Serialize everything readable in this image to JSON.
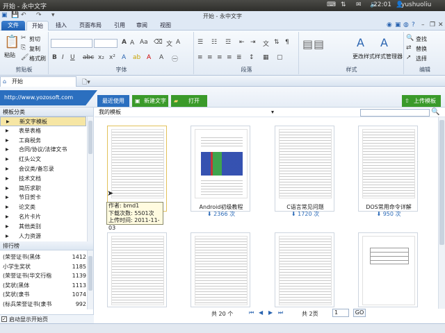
{
  "system_bar": {
    "window_title": "开始 - 永中文字",
    "time": "22:01",
    "user": "yushuoliu"
  },
  "app": {
    "title": "开始 - 永中文字"
  },
  "ribbon_tabs": [
    "文件",
    "开始",
    "插入",
    "页面布局",
    "引用",
    "审阅",
    "视图"
  ],
  "ribbon_groups": {
    "clipboard": {
      "label": "剪贴板",
      "paste": "粘贴",
      "cut": "剪切",
      "copy": "复制",
      "format_painter": "格式刷"
    },
    "font": {
      "label": "字体"
    },
    "paragraph": {
      "label": "段落"
    },
    "style": {
      "label": "样式",
      "change_style": "更改样式",
      "style_manager": "样式管理器"
    },
    "edit": {
      "label": "编辑",
      "find": "查找",
      "replace": "替换",
      "select": "选择"
    }
  },
  "doc_tab": {
    "label": "开始"
  },
  "banner": {
    "url": "http://www.yozosoft.com",
    "recent": "最近使用",
    "new_text": "新建文字",
    "open": "打开",
    "upload": "上传模板"
  },
  "sidebar": {
    "category_title": "模板分类",
    "categories": [
      "新文字模板",
      "表单表格",
      "工商税务",
      "合同/协议/法律文书",
      "红头公文",
      "会议类/备忘录",
      "技术文档",
      "简历求职",
      "节日贺卡",
      "论文类",
      "名片卡片",
      "其他类别",
      "人力资源"
    ],
    "ranking_title": "排行榜",
    "ranking": [
      {
        "name": "(荣誉证书(黑体",
        "count": "1412"
      },
      {
        "name": "小学生奖状",
        "count": "1185"
      },
      {
        "name": "(荣誉证书(华文行楷",
        "count": "1139"
      },
      {
        "name": "(奖状(黑体",
        "count": "1113"
      },
      {
        "name": "(奖状(隶书",
        "count": "1074"
      },
      {
        "name": "(标兵荣誉证书(隶书",
        "count": "992"
      }
    ],
    "startup_check": "启动显示开始页"
  },
  "content": {
    "heading": "我的模板",
    "sort": "▾",
    "cards": [
      {
        "name": "",
        "count": ""
      },
      {
        "name": "Android初级教程",
        "count": "2366 次"
      },
      {
        "name": "C语言常见问题",
        "count": "1720 次"
      },
      {
        "name": "DOS常用命令详解",
        "count": "950 次"
      },
      {
        "name": "",
        "count": ""
      },
      {
        "name": "",
        "count": ""
      },
      {
        "name": "",
        "count": ""
      },
      {
        "name": "",
        "count": ""
      }
    ],
    "tooltip": {
      "author": "作者: bmd1",
      "downloads": "下载次数: 5501次",
      "upload_time": "上传时间: 2011-11-03"
    },
    "pager": {
      "total": "共 20 个",
      "pages": "共 2页",
      "page_input": "1",
      "go": "GO"
    }
  },
  "colors": {
    "accent_blue": "#2b6fbf",
    "green_button": "#3a9a2a",
    "selected_item": "#f6e6a4"
  }
}
